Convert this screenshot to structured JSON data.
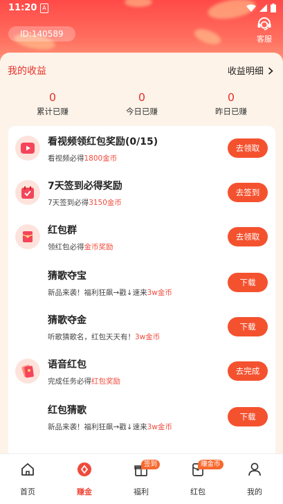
{
  "status_bar": {
    "time": "11:20",
    "sim_glyph": "A"
  },
  "header": {
    "user_id": "ID:140589",
    "customer_service_label": "客服"
  },
  "earnings": {
    "title": "我的收益",
    "detail_link": "收益明细",
    "stats": [
      {
        "value": "0",
        "label": "累计已赚"
      },
      {
        "value": "0",
        "label": "今日已赚"
      },
      {
        "value": "0",
        "label": "昨日已赚"
      }
    ]
  },
  "tasks": [
    {
      "name": "看视频领红包奖励(0/15)",
      "desc_prefix": "看视频必得",
      "desc_highlight": "1800金币",
      "desc_suffix": "",
      "button": "去领取",
      "icon": "video-play-icon"
    },
    {
      "name": "7天签到必得奖励",
      "desc_prefix": "7天签到必得",
      "desc_highlight": "3150金币",
      "desc_suffix": "",
      "button": "去签到",
      "icon": "calendar-check-icon"
    },
    {
      "name": "红包群",
      "desc_prefix": "领红包必得",
      "desc_highlight": "金币奖励",
      "desc_suffix": "",
      "button": "去领取",
      "icon": "red-envelope-icon"
    },
    {
      "name": "猜歌夺宝",
      "desc_prefix": "新品来袭！福利狂飙→戳↓速来",
      "desc_highlight": "3w金币",
      "desc_suffix": "",
      "button": "下载",
      "icon": ""
    },
    {
      "name": "猜歌夺金",
      "desc_prefix": "听歌猜歌名，红包天天有！",
      "desc_highlight": "3w金币",
      "desc_suffix": "",
      "button": "下载",
      "icon": ""
    },
    {
      "name": "语音红包",
      "desc_prefix": "完成任务必得",
      "desc_highlight": "红包奖励",
      "desc_suffix": "",
      "button": "去完成",
      "icon": "voice-red-envelope-icon"
    },
    {
      "name": "红包猜歌",
      "desc_prefix": "新品来袭！福利狂飙→戳↓速来",
      "desc_highlight": "3w金币",
      "desc_suffix": "",
      "button": "下载",
      "icon": ""
    }
  ],
  "nav": {
    "items": [
      {
        "label": "首页",
        "icon": "home-icon"
      },
      {
        "label": "赚金",
        "icon": "earn-icon"
      },
      {
        "label": "福利",
        "icon": "gift-icon",
        "badge": "签到"
      },
      {
        "label": "红包",
        "icon": "red-packet-icon",
        "badge": "赚金币"
      },
      {
        "label": "我的",
        "icon": "profile-icon"
      }
    ],
    "active": "赚金"
  },
  "colors": {
    "accent": "#f04a3c",
    "button": "#f4522f",
    "header_top": "#ff4a48",
    "page_bg": "#fdf3e9"
  }
}
